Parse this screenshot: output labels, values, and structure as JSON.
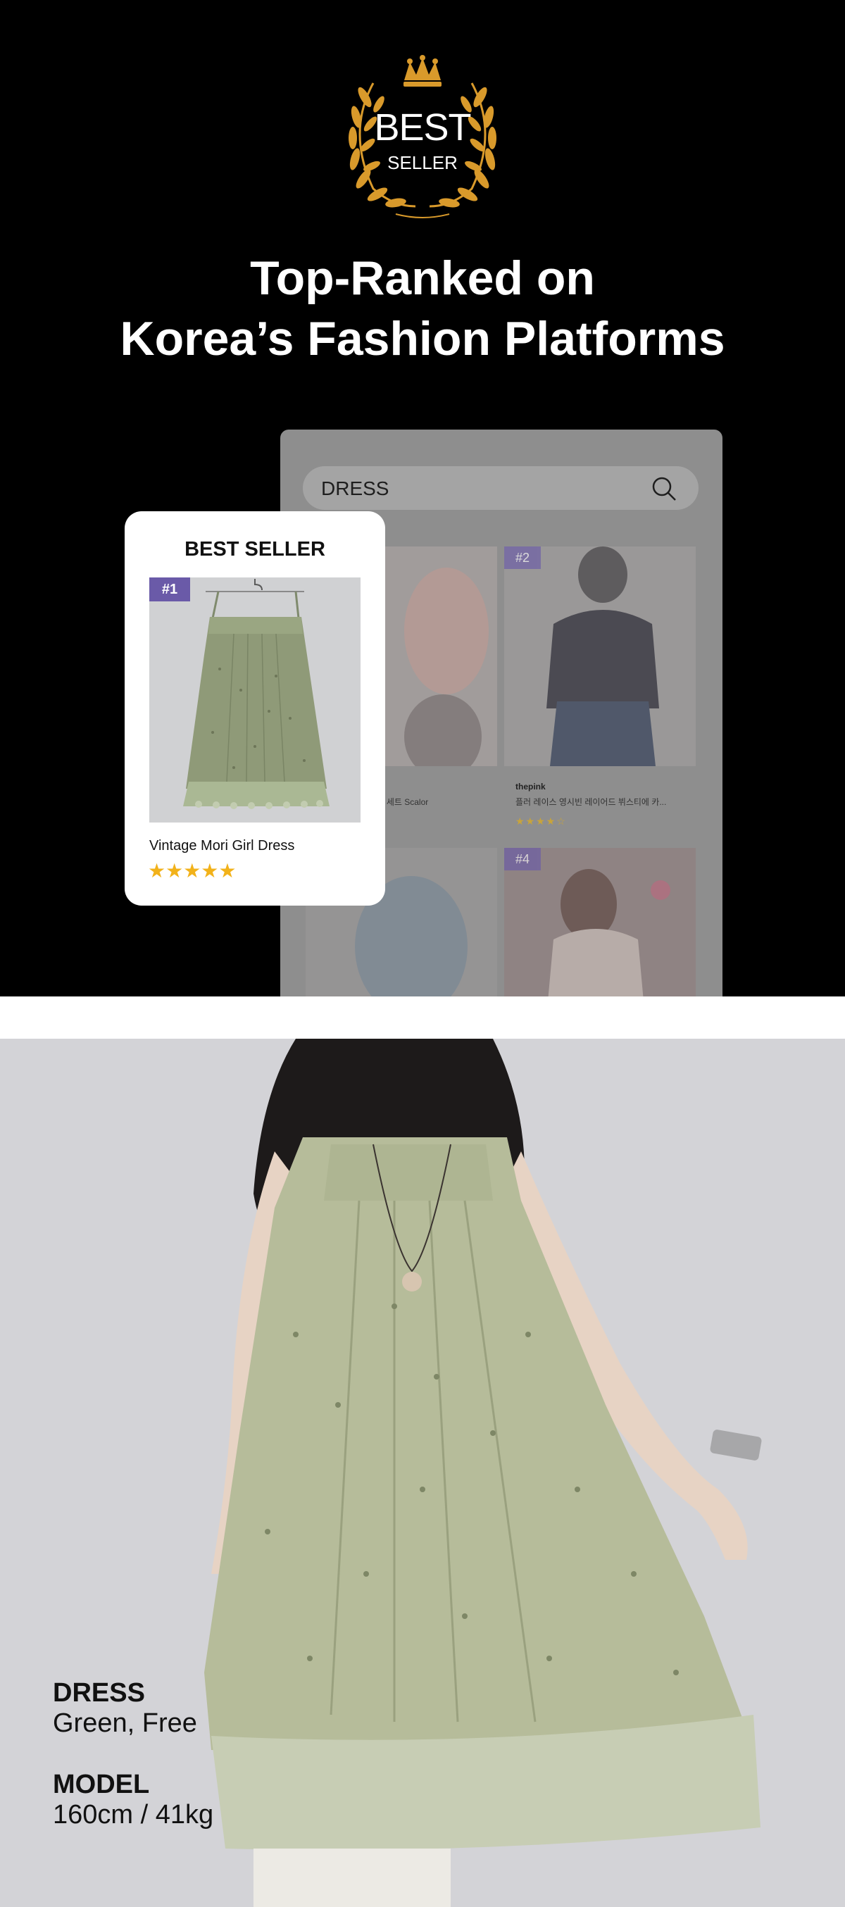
{
  "badge": {
    "line1": "BEST",
    "line2": "SELLER"
  },
  "headline": {
    "line1": "Top-Ranked on",
    "line2": "Korea’s Fashion Platforms"
  },
  "search": {
    "value": "DRESS"
  },
  "grid_items": [
    {
      "rank": "",
      "shop": "",
      "title": "버 기이튼 세트 Scalor"
    },
    {
      "rank": "#2",
      "shop": "thepink",
      "title": "플러 레이스 영시빈 레이어드 뷔스티에 카..."
    },
    {
      "rank": "",
      "shop": "",
      "title": ""
    },
    {
      "rank": "#4",
      "shop": "",
      "title": ""
    }
  ],
  "best_card": {
    "title": "BEST SELLER",
    "rank": "#1",
    "product_name": "Vintage Mori Girl Dress",
    "stars": "★★★★★",
    "rating": 5
  },
  "product_info": {
    "dress_label": "DRESS",
    "dress_value": "Green, Free",
    "model_label": "MODEL",
    "model_value": "160cm / 41kg"
  },
  "colors": {
    "accent_gold": "#d99a2b",
    "rank_purple": "#6a5aa8",
    "star_yellow": "#f2b21a"
  }
}
